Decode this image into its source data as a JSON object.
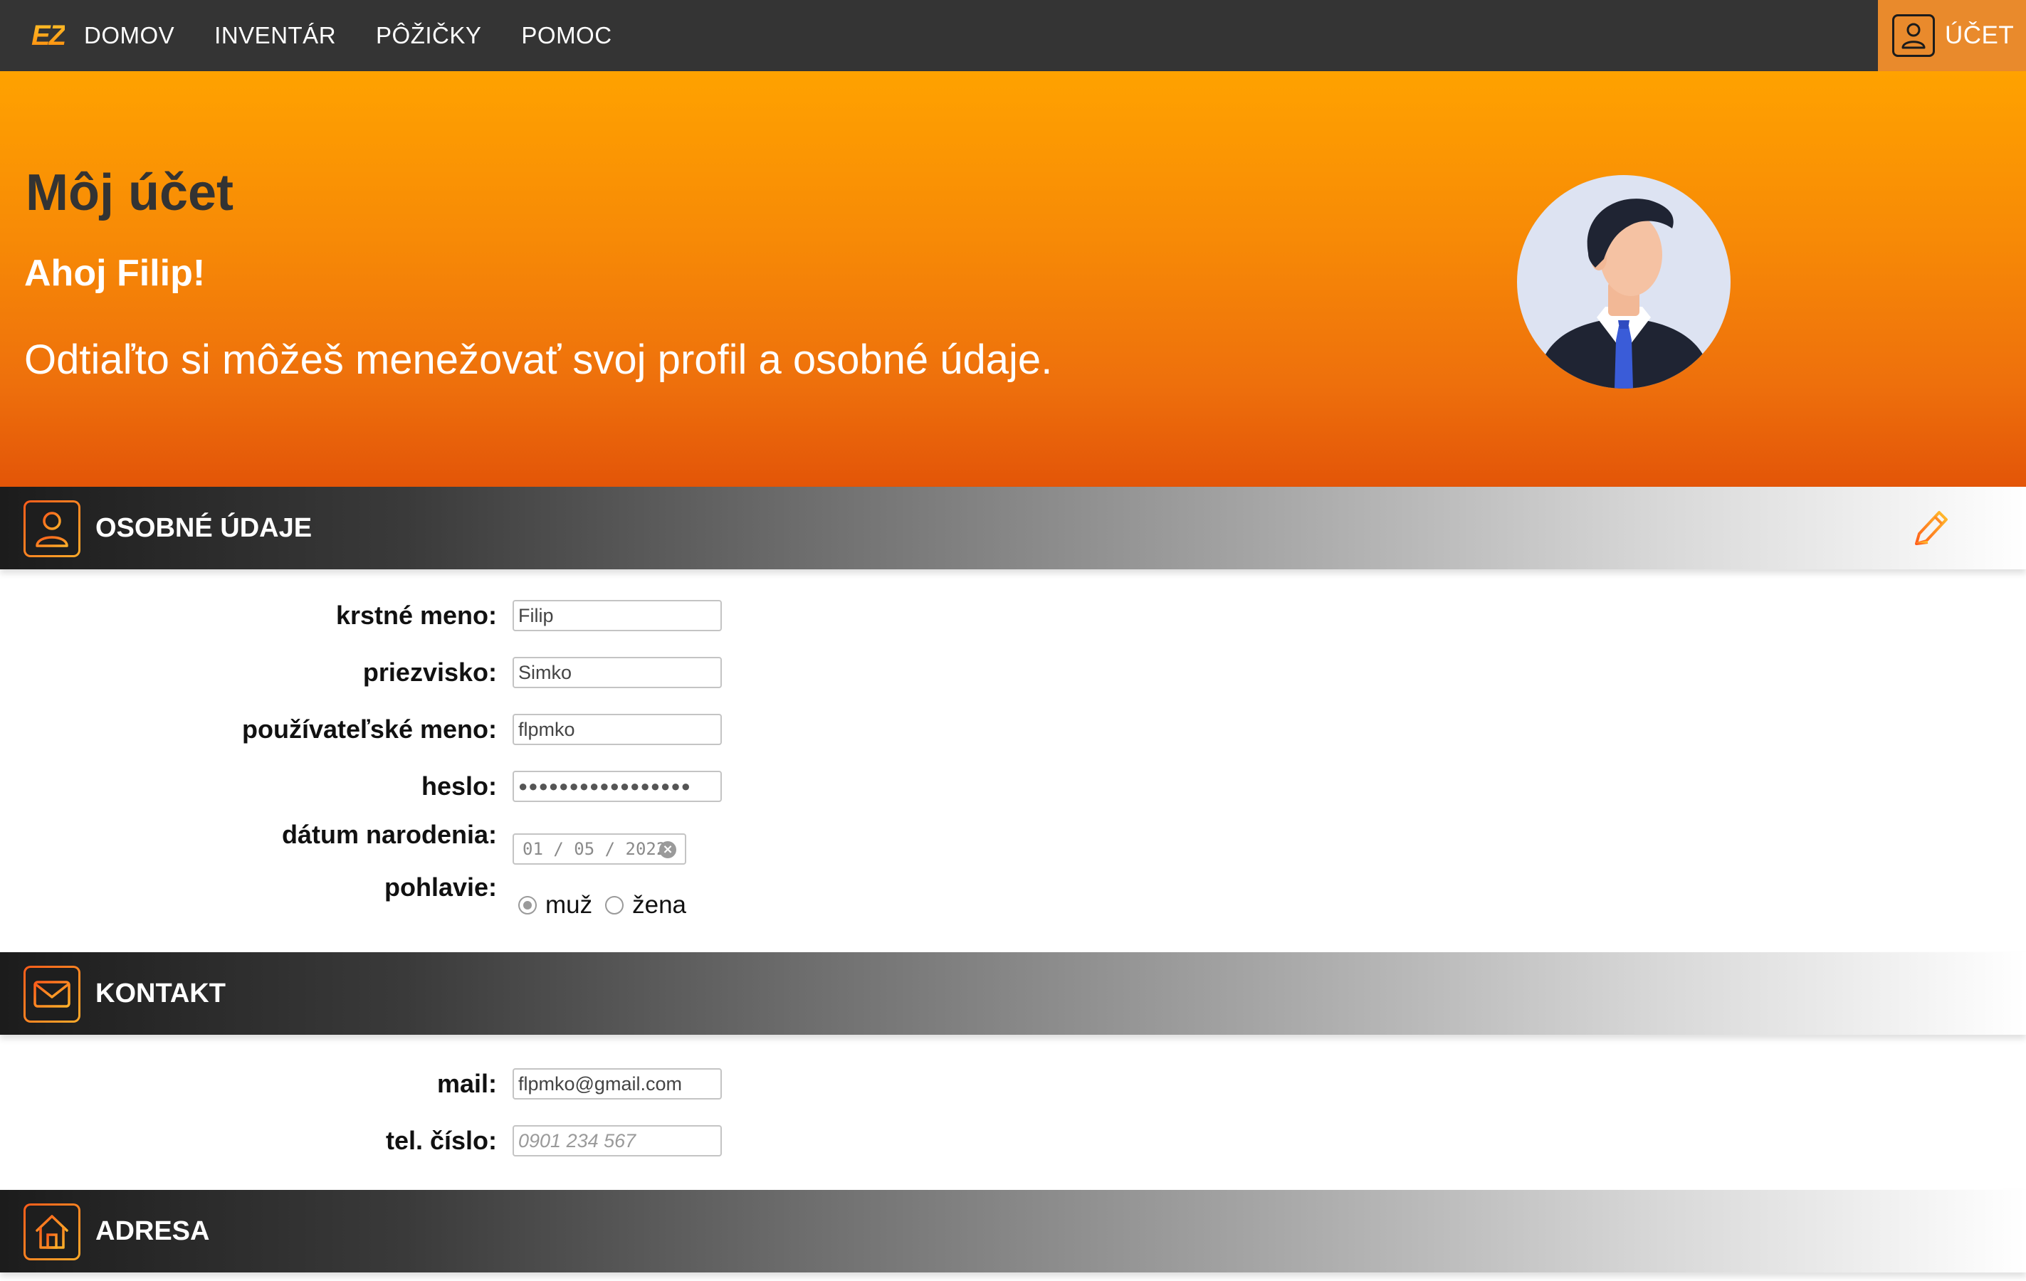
{
  "nav": {
    "logo": "EZ",
    "items": [
      "DOMOV",
      "INVENTÁR",
      "PÔŽIČKY",
      "POMOC"
    ],
    "account_label": "ÚČET"
  },
  "hero": {
    "title": "Môj účet",
    "greeting": "Ahoj Filip!",
    "subtitle": "Odtiaľto si môžeš menežovať svoj profil a osobné údaje."
  },
  "sections": {
    "personal": {
      "title": "OSOBNÉ ÚDAJE"
    },
    "contact": {
      "title": "KONTAKT"
    },
    "address": {
      "title": "ADRESA"
    }
  },
  "personal_form": {
    "first_name_label": "krstné meno:",
    "first_name_value": "Filip",
    "last_name_label": "priezvisko:",
    "last_name_value": "Simko",
    "username_label": "používateľské meno:",
    "username_value": "flpmko",
    "password_label": "heslo:",
    "password_value": "●●●●●●●●●●●●●●●●●",
    "birthdate_label": "dátum narodenia:",
    "birthdate_value": "01 / 05 / 2022",
    "gender_label": "pohlavie:",
    "gender_options": [
      "muž",
      "žena"
    ],
    "gender_selected": "muž"
  },
  "contact_form": {
    "mail_label": "mail:",
    "mail_value": "flpmko@gmail.com",
    "phone_label": "tel. číslo:",
    "phone_placeholder": "0901 234 567"
  },
  "colors": {
    "nav_bg": "#343434",
    "accent": "#e98a2c",
    "hero_top": "#ffa200",
    "hero_bottom": "#e35508"
  },
  "icons": {
    "personal": "user-icon",
    "contact": "mail-icon",
    "address": "house-icon",
    "edit": "pencil-icon",
    "account": "user-icon"
  }
}
